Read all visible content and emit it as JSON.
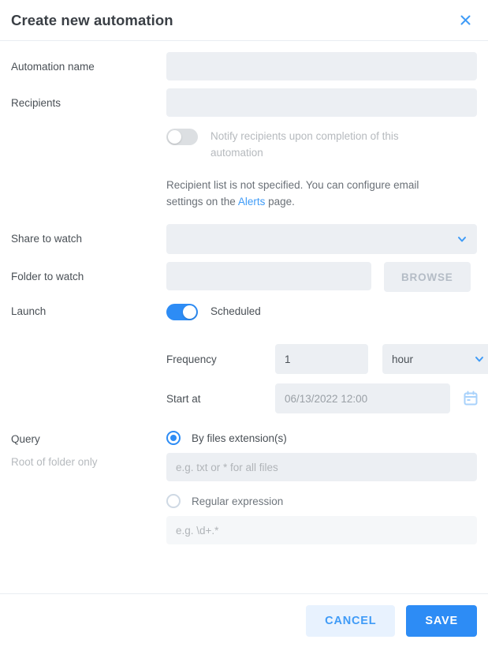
{
  "dialog": {
    "title": "Create new automation",
    "close_icon": "close-icon"
  },
  "fields": {
    "automation_name": {
      "label": "Automation name",
      "value": "",
      "placeholder": ""
    },
    "recipients": {
      "label": "Recipients",
      "value": "",
      "placeholder": ""
    },
    "notify_toggle": {
      "label": "Notify recipients upon completion of this automation",
      "state": "off"
    },
    "recipient_note": {
      "text_before": "Recipient list is not specified. You can configure email settings on the ",
      "link": "Alerts",
      "text_after": " page."
    },
    "share_to_watch": {
      "label": "Share to watch",
      "value": "",
      "caret_icon": "chevron-down-icon"
    },
    "folder_to_watch": {
      "label": "Folder to watch",
      "value": "",
      "placeholder": "",
      "browse_label": "BROWSE"
    },
    "launch": {
      "label": "Launch",
      "toggle_label": "Scheduled",
      "state": "on"
    },
    "frequency": {
      "label": "Frequency",
      "value": "1",
      "unit": "hour",
      "caret_icon": "chevron-down-icon"
    },
    "start_at": {
      "label": "Start at",
      "value": "06/13/2022 12:00",
      "calendar_icon": "calendar-icon"
    },
    "query": {
      "label": "Query",
      "sub_label": "Root of folder only",
      "option_extension": {
        "label": "By files extension(s)",
        "selected": true,
        "input_value": "",
        "placeholder": "e.g. txt or * for all files"
      },
      "option_regex": {
        "label": "Regular expression",
        "selected": false,
        "input_value": "",
        "placeholder": "e.g. \\d+.*"
      }
    }
  },
  "footer": {
    "cancel_label": "CANCEL",
    "save_label": "SAVE"
  },
  "colors": {
    "accent": "#2d8cf5",
    "link": "#3f9bf7",
    "field_bg": "#eceff3",
    "cancel_bg": "#e8f2fe"
  }
}
